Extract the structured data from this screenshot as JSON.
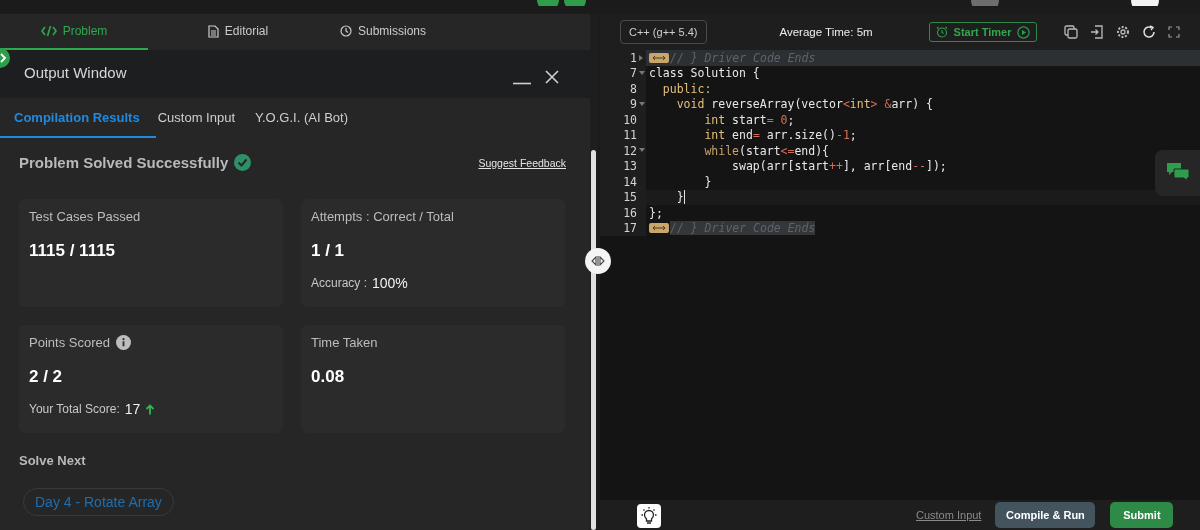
{
  "problem_panel": {
    "tabs": [
      {
        "label": "Problem",
        "kind": "code",
        "selected": true
      },
      {
        "label": "Editorial",
        "kind": "document",
        "selected": false
      },
      {
        "label": "Submissions",
        "kind": "clock",
        "selected": false
      }
    ],
    "output_window": {
      "title": "Output Window",
      "subtabs": [
        {
          "label": "Compilation Results",
          "selected": true
        },
        {
          "label": "Custom Input",
          "selected": false
        },
        {
          "label": "Y.O.G.I. (AI Bot)",
          "selected": false
        }
      ],
      "status": {
        "heading": "Problem Solved Successfully",
        "solved": true
      },
      "feedback_link": "Suggest Feedback",
      "cards": [
        {
          "label": "Test Cases Passed",
          "value": "1115 / 1115"
        },
        {
          "label": "Attempts : Correct / Total",
          "value": "1 / 1",
          "detail_label": "Accuracy :",
          "detail_value": "100%"
        },
        {
          "label": "Points Scored",
          "info": true,
          "value": "2 / 2",
          "detail_label": "Your Total Score:",
          "detail_value": "17",
          "trending_up": true
        },
        {
          "label": "Time Taken",
          "value": "0.08"
        }
      ],
      "solve_next": {
        "heading": "Solve Next",
        "items": [
          "Day 4 - Rotate Array"
        ]
      }
    }
  },
  "editor": {
    "language": "C++ (g++ 5.4)",
    "average_time": "Average Time: 5m",
    "timer_button": "Start Timer",
    "lines": [
      {
        "number": "1",
        "foldable": true,
        "folded": true,
        "marker": true,
        "highlighted": true,
        "tokens": [
          {
            "kind": "comment",
            "t": "// } Driver Code Ends"
          }
        ]
      },
      {
        "number": "7",
        "foldable": true,
        "folded": false,
        "tokens": [
          {
            "kind": "plain",
            "t": "class Solution {"
          }
        ]
      },
      {
        "number": "8",
        "tokens": [
          {
            "kind": "keyword",
            "t": "  public:"
          }
        ]
      },
      {
        "number": "9",
        "foldable": true,
        "folded": false,
        "tokens": [
          {
            "kind": "keyword",
            "t": "    void"
          },
          {
            "kind": "plain",
            "t": " reverseArray(vector"
          },
          {
            "kind": "operator",
            "t": "<"
          },
          {
            "kind": "keyword",
            "t": "int"
          },
          {
            "kind": "operator",
            "t": ">"
          },
          {
            "kind": "operator",
            "t": " &"
          },
          {
            "kind": "plain",
            "t": "arr) {"
          }
        ]
      },
      {
        "number": "10",
        "tokens": [
          {
            "kind": "keyword",
            "t": "        int"
          },
          {
            "kind": "plain",
            "t": " start"
          },
          {
            "kind": "operator",
            "t": "="
          },
          {
            "kind": "number",
            "t": " 0"
          },
          {
            "kind": "plain",
            "t": ";"
          }
        ]
      },
      {
        "number": "11",
        "tokens": [
          {
            "kind": "keyword",
            "t": "        int"
          },
          {
            "kind": "plain",
            "t": " end"
          },
          {
            "kind": "operator",
            "t": "="
          },
          {
            "kind": "plain",
            "t": " arr.size()"
          },
          {
            "kind": "operator",
            "t": "-"
          },
          {
            "kind": "number",
            "t": "1"
          },
          {
            "kind": "plain",
            "t": ";"
          }
        ]
      },
      {
        "number": "12",
        "foldable": true,
        "folded": false,
        "tokens": [
          {
            "kind": "control",
            "t": "        while"
          },
          {
            "kind": "plain",
            "t": "(start"
          },
          {
            "kind": "operator",
            "t": "<="
          },
          {
            "kind": "plain",
            "t": "end){"
          }
        ]
      },
      {
        "number": "13",
        "tokens": [
          {
            "kind": "plain",
            "t": "            swap(arr[start"
          },
          {
            "kind": "operator",
            "t": "++"
          },
          {
            "kind": "plain",
            "t": "], arr[end"
          },
          {
            "kind": "operator",
            "t": "--"
          },
          {
            "kind": "plain",
            "t": "]);"
          }
        ]
      },
      {
        "number": "14",
        "tokens": [
          {
            "kind": "plain",
            "t": "        }"
          }
        ]
      },
      {
        "number": "15",
        "current": true,
        "tokens": [
          {
            "kind": "plain",
            "t": "    }"
          }
        ]
      },
      {
        "number": "16",
        "tokens": [
          {
            "kind": "plain",
            "t": "};"
          }
        ]
      },
      {
        "number": "17",
        "marker": true,
        "tokens": [
          {
            "kind": "comment",
            "t": "// } Driver Code Ends"
          }
        ]
      }
    ]
  },
  "footer": {
    "custom_input_link": "Custom Input",
    "compile_button": "Compile & Run",
    "submit_button": "Submit"
  }
}
